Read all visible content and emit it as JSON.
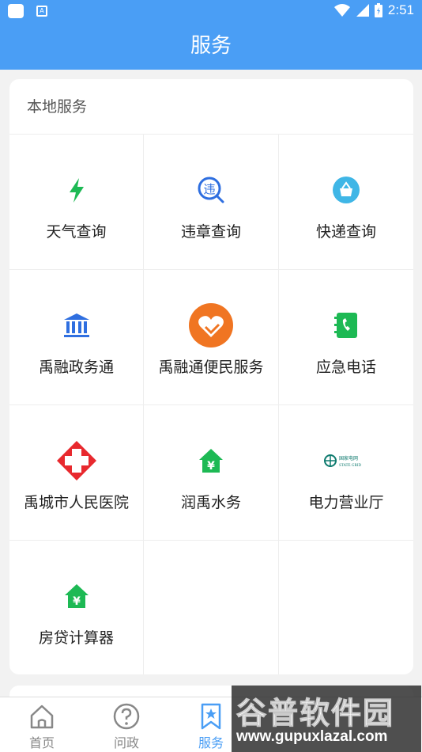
{
  "status_bar": {
    "time": "2:51",
    "icons": [
      "app-icon",
      "a-notification-icon",
      "wifi-icon",
      "signal-icon",
      "battery-icon"
    ]
  },
  "header": {
    "title": "服务"
  },
  "local_services": {
    "title": "本地服务",
    "items": [
      {
        "label": "天气查询",
        "icon": "lightning-icon"
      },
      {
        "label": "违章查询",
        "icon": "violation-search-icon"
      },
      {
        "label": "快递查询",
        "icon": "parcel-icon"
      },
      {
        "label": "禹融政务通",
        "icon": "government-building-icon"
      },
      {
        "label": "禹融通便民服务",
        "icon": "heart-hands-icon"
      },
      {
        "label": "应急电话",
        "icon": "phone-book-icon"
      },
      {
        "label": "禹城市人民医院",
        "icon": "hospital-cross-icon"
      },
      {
        "label": "润禹水务",
        "icon": "house-yen-icon"
      },
      {
        "label": "电力营业厅",
        "icon": "state-grid-logo-icon"
      },
      {
        "label": "房贷计算器",
        "icon": "house-yen-icon"
      }
    ]
  },
  "state_grid_logo_text": {
    "cn": "国家电网",
    "en": "STATE GRID"
  },
  "tab_bar": {
    "tabs": [
      {
        "label": "首页",
        "icon": "home-icon",
        "active": false
      },
      {
        "label": "问政",
        "icon": "question-icon",
        "active": false
      },
      {
        "label": "服务",
        "icon": "bookmark-star-icon",
        "active": true
      }
    ]
  },
  "watermark": {
    "title": "谷普软件园",
    "url": "www.gupuxlazal.com"
  },
  "colors": {
    "primary": "#4a9ef5",
    "green": "#1db954",
    "orange": "#f07522",
    "red": "#e8292e"
  }
}
